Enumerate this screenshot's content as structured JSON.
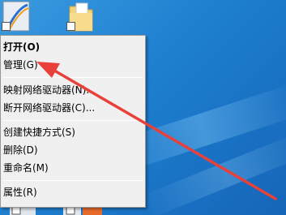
{
  "menu": {
    "open": "打开(O)",
    "manage": "管理(G)",
    "map_drive": "映射网络驱动器(N)...",
    "disconnect_drive": "断开网络驱动器(C)...",
    "create_shortcut": "创建快捷方式(S)",
    "delete": "删除(D)",
    "rename": "重命名(M)",
    "properties": "属性(R)"
  },
  "colors": {
    "desktop": "#1e7fd0",
    "menu_bg": "#f0f0f0",
    "annotation_arrow": "#e8403a"
  },
  "icons": {
    "top_left": "computer-icon",
    "top_middle": "folder-icon"
  }
}
